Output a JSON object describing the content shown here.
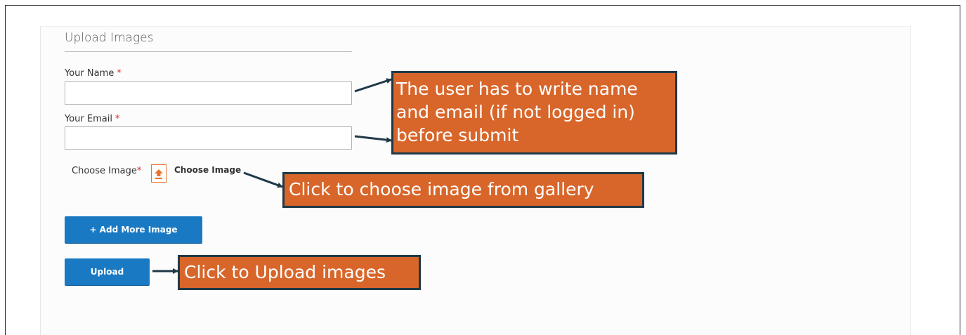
{
  "form": {
    "title": "Upload Images",
    "name_label": "Your Name",
    "email_label": "Your Email",
    "required_mark": "*",
    "name_value": "",
    "email_value": "",
    "choose_image_label": "Choose Image",
    "choose_image_link": "Choose Image",
    "add_more_button": "+ Add More Image",
    "upload_button": "Upload"
  },
  "annotations": {
    "callout_name_email": [
      "The user has to write name",
      "and email (if not logged in)",
      "before submit"
    ],
    "callout_choose": "Click to choose image from gallery",
    "callout_upload": "Click to Upload images"
  },
  "icons": {
    "upload": "upload-arrow-icon"
  },
  "colors": {
    "primary_button": "#1979c3",
    "required": "#e02b27",
    "callout_fill": "#d8662a",
    "callout_border": "#1f3947",
    "upload_icon": "#e8722e"
  }
}
